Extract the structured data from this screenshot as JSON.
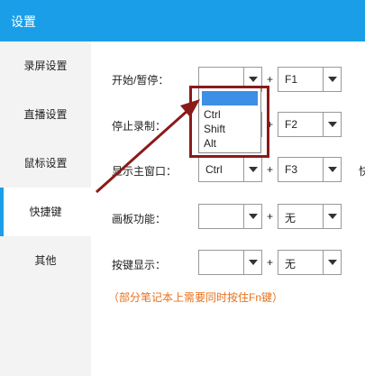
{
  "window": {
    "title": "设置"
  },
  "sidebar": {
    "items": [
      {
        "label": "录屏设置"
      },
      {
        "label": "直播设置"
      },
      {
        "label": "鼠标设置"
      },
      {
        "label": "快捷键"
      },
      {
        "label": "其他"
      }
    ],
    "active_index": 3
  },
  "shortcuts": [
    {
      "label": "开始/暂停：",
      "modifier": "",
      "key": "F1"
    },
    {
      "label": "停止录制：",
      "modifier": "",
      "key": "F2"
    },
    {
      "label": "显示主窗口：",
      "modifier": "Ctrl",
      "key": "F3"
    },
    {
      "label": "画板功能：",
      "modifier": "",
      "key": "无"
    },
    {
      "label": "按键显示：",
      "modifier": "",
      "key": "无"
    }
  ],
  "plus_sign": "+",
  "modifier_options": [
    "",
    "Ctrl",
    "Shift",
    "Alt"
  ],
  "note": "（部分笔记本上需要同时按住Fn键）",
  "cut_off_text": "快",
  "colors": {
    "titlebar": "#1a9ee8",
    "accent": "#1a9ee8",
    "note": "#e8701a",
    "annotation": "#8b1a1a",
    "highlight": "#3c8fe6"
  }
}
